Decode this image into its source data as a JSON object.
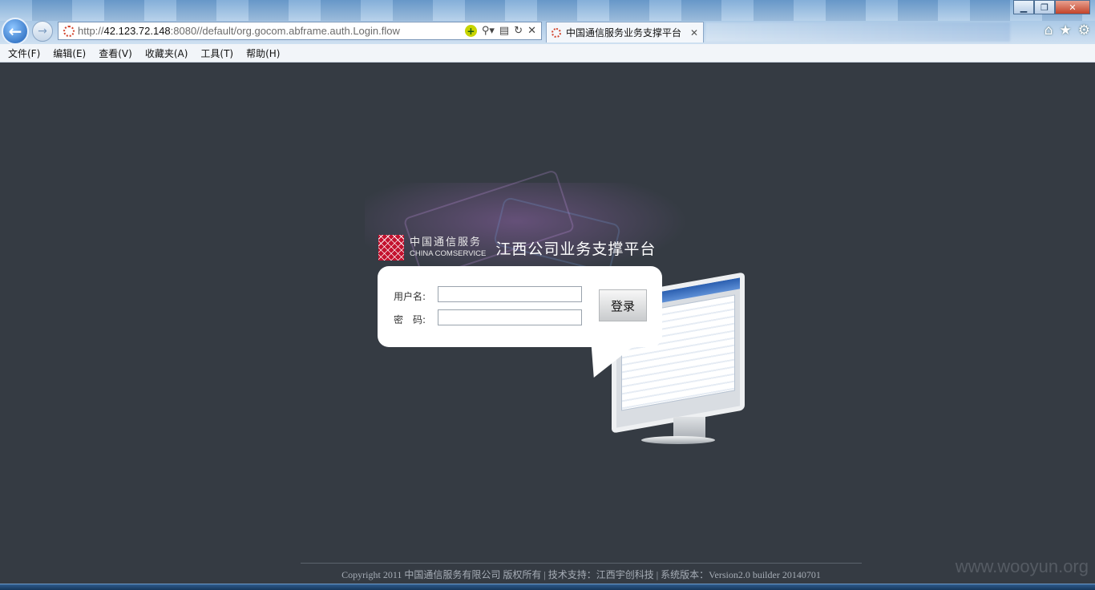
{
  "browser": {
    "url_prefix": "http://",
    "url_host": "42.123.72.148",
    "url_rest": ":8080//default/org.gocom.abframe.auth.Login.flow",
    "tab_title": "中国通信服务业务支撑平台",
    "window_buttons": [
      "minimize-icon",
      "restore-icon",
      "close-icon"
    ],
    "toolbar_icons": [
      "home-icon",
      "favorites-star-icon",
      "settings-gear-icon"
    ]
  },
  "menubar": {
    "items": [
      "文件(F)",
      "编辑(E)",
      "查看(V)",
      "收藏夹(A)",
      "工具(T)",
      "帮助(H)"
    ]
  },
  "brand": {
    "logo_cn": "中国通信服务",
    "logo_en": "CHINA COMSERVICE",
    "app_title": "江西公司业务支撑平台"
  },
  "login": {
    "username_label": "用户名:",
    "password_label": "密　码:",
    "username_value": "",
    "password_value": "",
    "submit_label": "登录"
  },
  "footer": {
    "text": "Copyright 2011 中国通信服务有限公司  版权所有 | 技术支持：江西宇创科技 | 系统版本：Version2.0 builder 20140701"
  },
  "watermark": "www.wooyun.org",
  "colors": {
    "page_background": "#353b43",
    "brand_red": "#c4122f"
  }
}
